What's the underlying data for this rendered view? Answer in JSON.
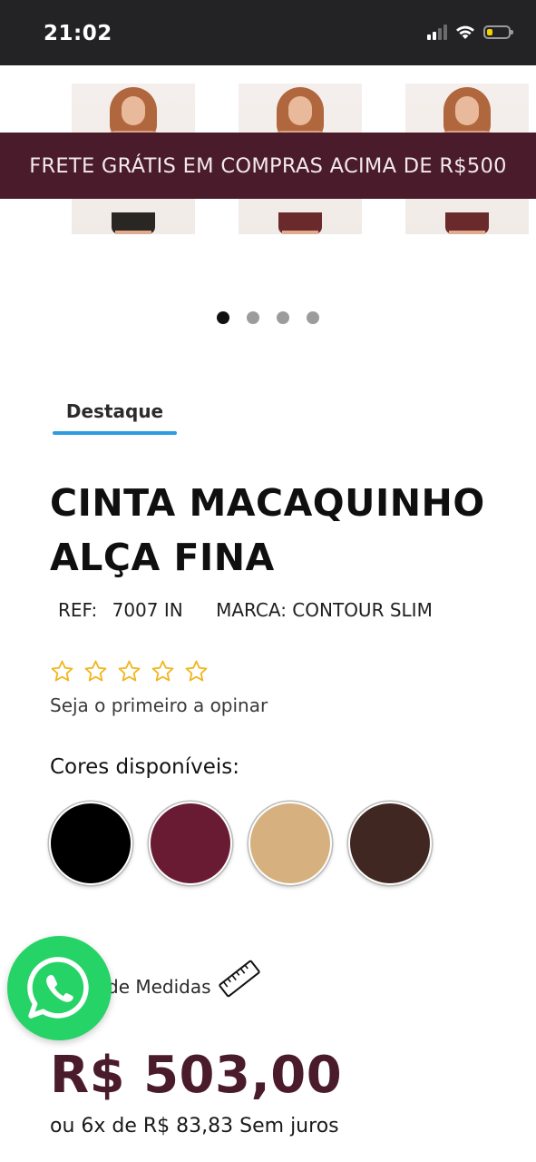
{
  "status_bar": {
    "time": "21:02",
    "icons": [
      "cellular-signal-icon",
      "wifi-icon",
      "battery-icon"
    ],
    "battery_level": 0.25
  },
  "carousel": {
    "images": [
      {
        "name": "model-front-black",
        "shorts_color": "#2a2624"
      },
      {
        "name": "model-front-wine",
        "shorts_color": "#6a2a2c"
      },
      {
        "name": "model-side-wine",
        "shorts_color": "#6a2a2c"
      }
    ],
    "dots": 4,
    "active_dot": 1
  },
  "promo_banner": {
    "text": "FRETE GRÁTIS EM COMPRAS ACIMA DE R$500",
    "background": "#4a1b2a"
  },
  "tab": {
    "label": "Destaque",
    "accent": "#2e9be0"
  },
  "product": {
    "title_line1": "CINTA MACAQUINHO",
    "title_line2": "ALÇA FINA",
    "ref_label": "REF:",
    "ref_value": "7007 IN",
    "brand": "MARCA: CONTOUR SLIM",
    "rating_stars": 5,
    "rating_value": 0,
    "review_prompt": "Seja o primeiro a opinar",
    "colors_label": "Cores disponíveis:",
    "colors": [
      "#000000",
      "#6a1b34",
      "#d6b17f",
      "#402722"
    ],
    "size_chart_label": "de Medidas",
    "price": "R$ 503,00",
    "price_color": "#4a1b2a",
    "installments": "ou 6x de R$ 83,83 Sem juros"
  },
  "whatsapp": {
    "icon": "whatsapp-icon",
    "color": "#25d366"
  }
}
